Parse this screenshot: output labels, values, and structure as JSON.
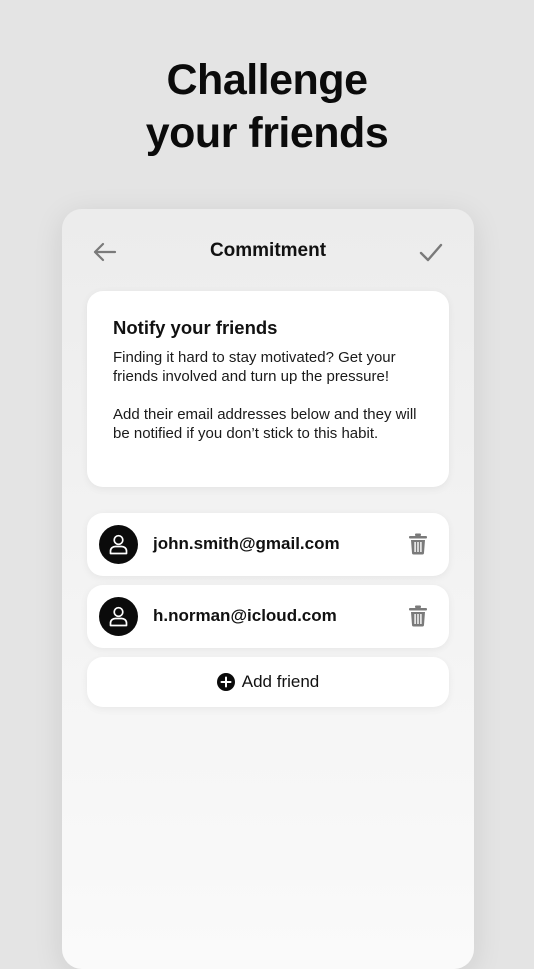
{
  "headline": {
    "line1": "Challenge",
    "line2": "your friends"
  },
  "navbar": {
    "title": "Commitment",
    "back_icon": "arrow-left-icon",
    "confirm_icon": "checkmark-icon"
  },
  "info_card": {
    "title": "Notify your friends",
    "paragraph1": "Finding it hard to stay motivated? Get your friends involved and turn up the pressure!",
    "paragraph2": "Add their email addresses below and they will be notified if you don’t stick to this habit."
  },
  "friends": [
    {
      "email": "john.smith@gmail.com",
      "avatar_icon": "user-icon",
      "delete_icon": "trash-icon"
    },
    {
      "email": "h.norman@icloud.com",
      "avatar_icon": "user-icon",
      "delete_icon": "trash-icon"
    }
  ],
  "add_friend": {
    "label": "Add friend",
    "icon": "plus-circle-icon"
  },
  "colors": {
    "background": "#e4e4e4",
    "card": "#ffffff",
    "text": "#111111",
    "icon_gray": "#7a7a7a",
    "avatar": "#0b0b0b"
  }
}
